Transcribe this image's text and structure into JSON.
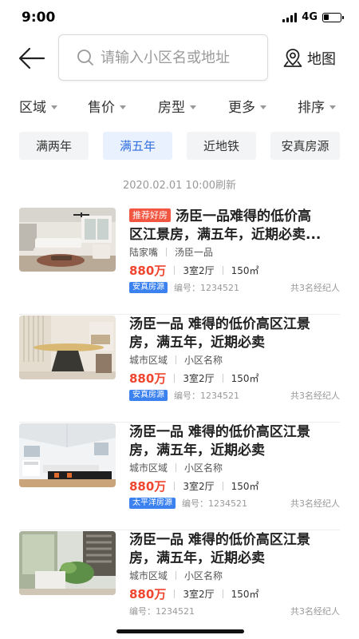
{
  "status_bar": {
    "time": "9:00",
    "network": "4G"
  },
  "header": {
    "search_placeholder": "请输入小区名或地址",
    "map_label": "地图"
  },
  "filters": [
    {
      "label": "区域"
    },
    {
      "label": "售价"
    },
    {
      "label": "房型"
    },
    {
      "label": "更多"
    },
    {
      "label": "排序"
    }
  ],
  "tags": [
    {
      "label": "满两年",
      "active": false
    },
    {
      "label": "满五年",
      "active": true
    },
    {
      "label": "近地铁",
      "active": false
    },
    {
      "label": "安真房源",
      "active": false
    }
  ],
  "refresh_time": "2020.02.01  10:00刷新",
  "colors": {
    "accent": "#2f6fe0",
    "price": "#f0452f",
    "badge_red": "#f25540",
    "badge_blue": "#3b82f0"
  },
  "listings": [
    {
      "badge": "推荐好房",
      "title_line1": "汤臣一品难得的低价高",
      "title_line2": "区江景房，满五年，近期必卖...",
      "district": "陆家嘴",
      "community": "汤臣一品",
      "price": "880万",
      "layout": "3室2厅",
      "area": "150㎡",
      "source": "安真房源",
      "code": "编号：1234521",
      "agents": "共3名经纪人",
      "image": "living-room-photo"
    },
    {
      "badge": "",
      "title_line1": "汤臣一品   难得的低价高区江景",
      "title_line2": "房，满五年，近期必卖",
      "district": "城市区域",
      "community": "小区名称",
      "price": "880万",
      "layout": "3室2厅",
      "area": "150㎡",
      "source": "安真房源",
      "code": "编号：1234521",
      "agents": "共3名经纪人",
      "image": "dining-room-photo"
    },
    {
      "badge": "",
      "title_line1": "汤臣一品   难得的低价高区江景",
      "title_line2": "房，满五年，近期必卖",
      "district": "城市区域",
      "community": "小区名称",
      "price": "880万",
      "layout": "3室2厅",
      "area": "150㎡",
      "source": "太平洋房源",
      "code": "编号：1234521",
      "agents": "共3名经纪人",
      "image": "attic-room-photo"
    },
    {
      "badge": "",
      "title_line1": "汤臣一品   难得的低价高区江景",
      "title_line2": "房，满五年，近期必卖",
      "district": "城市区域",
      "community": "小区名称",
      "price": "880万",
      "layout": "3室2厅",
      "area": "150㎡",
      "source": "",
      "code": "编号：1234521",
      "agents": "共3名经纪人",
      "image": "plant-room-photo"
    }
  ]
}
